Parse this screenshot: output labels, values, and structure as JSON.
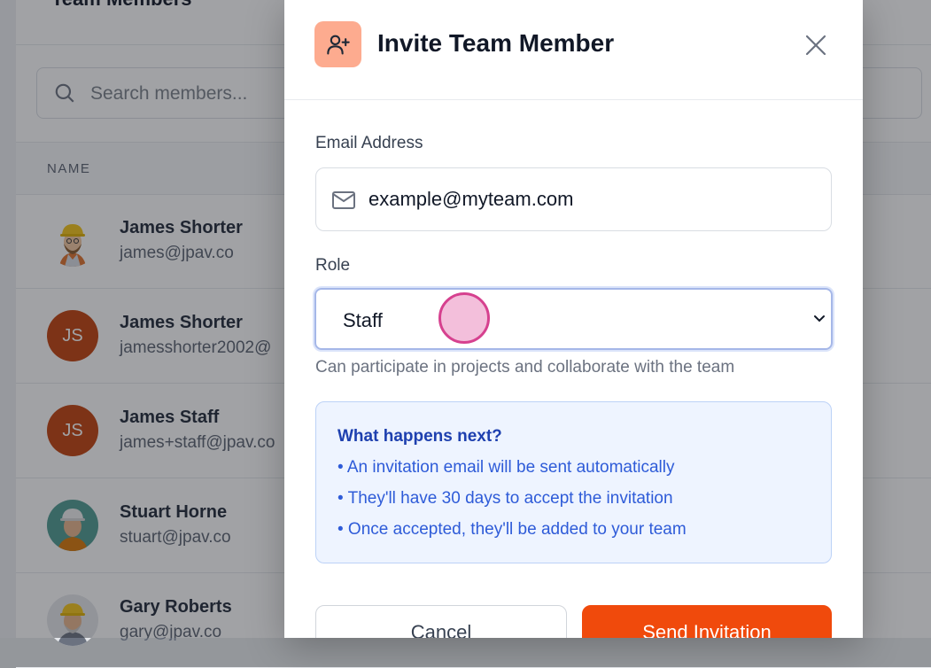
{
  "background": {
    "page_title": "Team Members",
    "search": {
      "placeholder": "Search members..."
    },
    "table": {
      "header_name": "NAME",
      "rows": [
        {
          "name": "James Shorter",
          "email": "james@jpav.co",
          "avatar": "photo",
          "initials": ""
        },
        {
          "name": "James Shorter",
          "email": "jamesshorter2002@",
          "avatar": "initials",
          "initials": "JS"
        },
        {
          "name": "James Staff",
          "email": "james+staff@jpav.co",
          "avatar": "initials",
          "initials": "JS"
        },
        {
          "name": "Stuart Horne",
          "email": "stuart@jpav.co",
          "avatar": "photo",
          "initials": ""
        },
        {
          "name": "Gary Roberts",
          "email": "gary@jpav.co",
          "avatar": "photo",
          "initials": ""
        }
      ]
    }
  },
  "modal": {
    "title": "Invite Team Member",
    "header_icon": "user-plus-icon",
    "close_icon": "close-icon",
    "email": {
      "label": "Email Address",
      "value": "example@myteam.com",
      "icon": "mail-icon"
    },
    "role": {
      "label": "Role",
      "selected": "Staff",
      "help": "Can participate in projects and collaborate with the team",
      "icon": "chevron-down-icon"
    },
    "info": {
      "title": "What happens next?",
      "items": [
        "• An invitation email will be sent automatically",
        "• They'll have 30 days to accept the invitation",
        "• Once accepted, they'll be added to your team"
      ]
    },
    "buttons": {
      "cancel": "Cancel",
      "send": "Send Invitation"
    }
  },
  "colors": {
    "accent": "#f04a0c",
    "icon_bg": "#fdab8f",
    "info_bg": "#eef4ff",
    "info_text": "#2e5bd8",
    "avatar_initials_bg": "#c2410c"
  }
}
